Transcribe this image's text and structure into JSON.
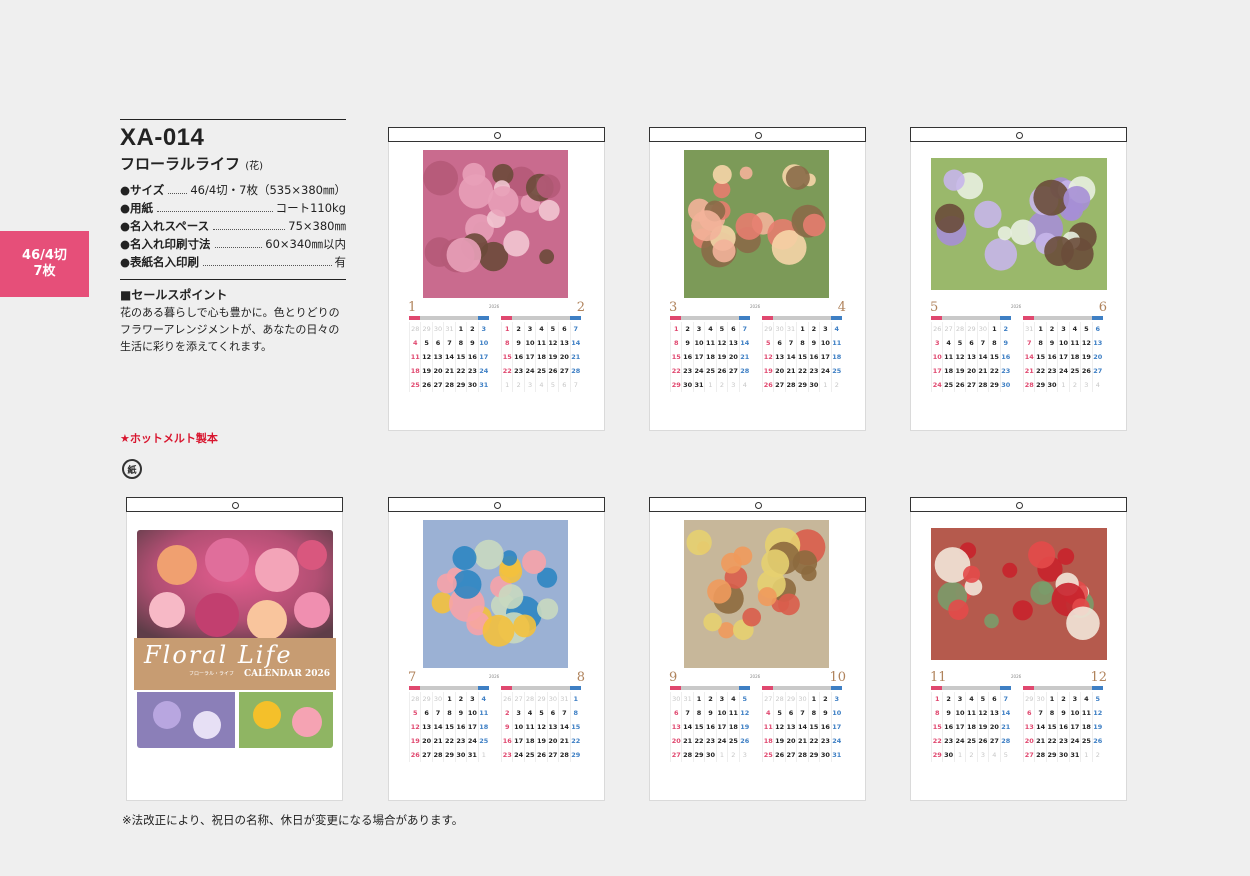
{
  "size_tab": {
    "line1": "46/4切",
    "line2": "7枚"
  },
  "product": {
    "code": "XA-014",
    "name": "フローラルライフ",
    "name_note": "(花)",
    "specs": [
      {
        "label": "●サイズ",
        "value": "46/4切・7枚（535×380㎜）"
      },
      {
        "label": "●用紙",
        "value": "コート110kg"
      },
      {
        "label": "●名入れスペース",
        "value": "75×380㎜"
      },
      {
        "label": "●名入れ印刷寸法",
        "value": "60×340㎜以内"
      },
      {
        "label": "●表紙名入印刷",
        "value": "有"
      }
    ],
    "sales_head": "■セールスポイント",
    "sales_body": "花のある暮らしで心も豊かに。色とりどりのフラワーアレンジメントが、あなたの日々の生活に彩りを添えてくれます。"
  },
  "hotmelt": "★ホットメルト製本",
  "recycle_label": "紙",
  "footnote": "※法改正により、祝日の名称、休日が変更になる場合があります。",
  "cover": {
    "title": "Floral Life",
    "subtitle": "フローラル・ライフ",
    "calendar": "CALENDAR 2026"
  },
  "year": "2026",
  "months": [
    {
      "left": "1",
      "right": "2",
      "l_weeks": [
        "28",
        "29",
        "30",
        "31",
        "1",
        "2",
        "3",
        "4",
        "5",
        "6",
        "7",
        "8",
        "9",
        "10",
        "11",
        "12",
        "13",
        "14",
        "15",
        "16",
        "17",
        "18",
        "19",
        "20",
        "21",
        "22",
        "23",
        "24",
        "25",
        "26",
        "27",
        "28",
        "29",
        "30",
        "31"
      ],
      "r_weeks": [
        "1",
        "2",
        "3",
        "4",
        "5",
        "6",
        "7",
        "8",
        "9",
        "10",
        "11",
        "12",
        "13",
        "14",
        "15",
        "16",
        "17",
        "18",
        "19",
        "20",
        "21",
        "22",
        "23",
        "24",
        "25",
        "26",
        "27",
        "28",
        "1",
        "2",
        "3",
        "4",
        "5",
        "6",
        "7"
      ]
    },
    {
      "left": "3",
      "right": "4",
      "l_weeks": [
        "1",
        "2",
        "3",
        "4",
        "5",
        "6",
        "7",
        "8",
        "9",
        "10",
        "11",
        "12",
        "13",
        "14",
        "15",
        "16",
        "17",
        "18",
        "19",
        "20",
        "21",
        "22",
        "23",
        "24",
        "25",
        "26",
        "27",
        "28",
        "29",
        "30",
        "31",
        "1",
        "2",
        "3",
        "4"
      ],
      "r_weeks": [
        "29",
        "30",
        "31",
        "1",
        "2",
        "3",
        "4",
        "5",
        "6",
        "7",
        "8",
        "9",
        "10",
        "11",
        "12",
        "13",
        "14",
        "15",
        "16",
        "17",
        "18",
        "19",
        "20",
        "21",
        "22",
        "23",
        "24",
        "25",
        "26",
        "27",
        "28",
        "29",
        "30",
        "1",
        "2"
      ]
    },
    {
      "left": "5",
      "right": "6",
      "l_weeks": [
        "26",
        "27",
        "28",
        "29",
        "30",
        "1",
        "2",
        "3",
        "4",
        "5",
        "6",
        "7",
        "8",
        "9",
        "10",
        "11",
        "12",
        "13",
        "14",
        "15",
        "16",
        "17",
        "18",
        "19",
        "20",
        "21",
        "22",
        "23",
        "24",
        "25",
        "26",
        "27",
        "28",
        "29",
        "30"
      ],
      "r_weeks": [
        "31",
        "1",
        "2",
        "3",
        "4",
        "5",
        "6",
        "7",
        "8",
        "9",
        "10",
        "11",
        "12",
        "13",
        "14",
        "15",
        "16",
        "17",
        "18",
        "19",
        "20",
        "21",
        "22",
        "23",
        "24",
        "25",
        "26",
        "27",
        "28",
        "29",
        "30",
        "1",
        "2",
        "3",
        "4"
      ]
    },
    {
      "left": "7",
      "right": "8",
      "l_weeks": [
        "28",
        "29",
        "30",
        "1",
        "2",
        "3",
        "4",
        "5",
        "6",
        "7",
        "8",
        "9",
        "10",
        "11",
        "12",
        "13",
        "14",
        "15",
        "16",
        "17",
        "18",
        "19",
        "20",
        "21",
        "22",
        "23",
        "24",
        "25",
        "26",
        "27",
        "28",
        "29",
        "30",
        "31",
        "1"
      ],
      "r_weeks": [
        "26",
        "27",
        "28",
        "29",
        "30",
        "31",
        "1",
        "2",
        "3",
        "4",
        "5",
        "6",
        "7",
        "8",
        "9",
        "10",
        "11",
        "12",
        "13",
        "14",
        "15",
        "16",
        "17",
        "18",
        "19",
        "20",
        "21",
        "22",
        "23",
        "24",
        "25",
        "26",
        "27",
        "28",
        "29"
      ]
    },
    {
      "left": "9",
      "right": "10",
      "l_weeks": [
        "30",
        "31",
        "1",
        "2",
        "3",
        "4",
        "5",
        "6",
        "7",
        "8",
        "9",
        "10",
        "11",
        "12",
        "13",
        "14",
        "15",
        "16",
        "17",
        "18",
        "19",
        "20",
        "21",
        "22",
        "23",
        "24",
        "25",
        "26",
        "27",
        "28",
        "29",
        "30",
        "1",
        "2",
        "3"
      ],
      "r_weeks": [
        "27",
        "28",
        "29",
        "30",
        "1",
        "2",
        "3",
        "4",
        "5",
        "6",
        "7",
        "8",
        "9",
        "10",
        "11",
        "12",
        "13",
        "14",
        "15",
        "16",
        "17",
        "18",
        "19",
        "20",
        "21",
        "22",
        "23",
        "24",
        "25",
        "26",
        "27",
        "28",
        "29",
        "30",
        "31"
      ]
    },
    {
      "left": "11",
      "right": "12",
      "l_weeks": [
        "1",
        "2",
        "3",
        "4",
        "5",
        "6",
        "7",
        "8",
        "9",
        "10",
        "11",
        "12",
        "13",
        "14",
        "15",
        "16",
        "17",
        "18",
        "19",
        "20",
        "21",
        "22",
        "23",
        "24",
        "25",
        "26",
        "27",
        "28",
        "29",
        "30",
        "1",
        "2",
        "3",
        "4",
        "5"
      ],
      "r_weeks": [
        "29",
        "30",
        "1",
        "2",
        "3",
        "4",
        "5",
        "6",
        "7",
        "8",
        "9",
        "10",
        "11",
        "12",
        "13",
        "14",
        "15",
        "16",
        "17",
        "18",
        "19",
        "20",
        "21",
        "22",
        "23",
        "24",
        "25",
        "26",
        "27",
        "28",
        "29",
        "30",
        "31",
        "1",
        "2"
      ]
    }
  ],
  "colors": {
    "accent": "#e64f79",
    "holiday": "#e0486f",
    "saturday": "#3e7fc4",
    "month_number": "#b0835c",
    "hotmelt": "#d8152e",
    "cover_band": "#c79c72"
  }
}
